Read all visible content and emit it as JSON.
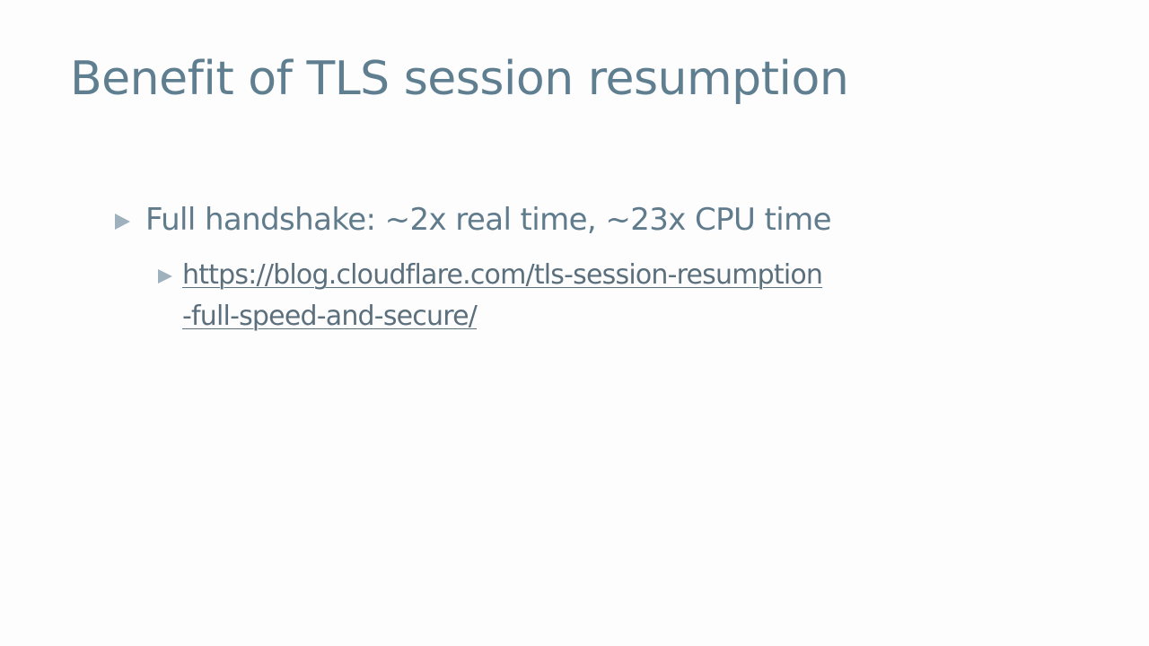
{
  "slide": {
    "title": "Benefit of TLS session resumption",
    "bullets": [
      {
        "text": "Full handshake: ~2x real time, ~23x CPU time",
        "sub_bullets": [
          {
            "link_text": "https://blog.cloudflare.com/tls-session-resumption-full-speed-and-secure/"
          }
        ]
      }
    ]
  },
  "colors": {
    "background": "#fdfdfd",
    "title": "#5f7f91",
    "body_text": "#5f7b8c",
    "link": "#5b6f7c",
    "bullet_marker": "#9fb1bd"
  },
  "icons": {
    "bullet": "triangle-right-icon"
  }
}
